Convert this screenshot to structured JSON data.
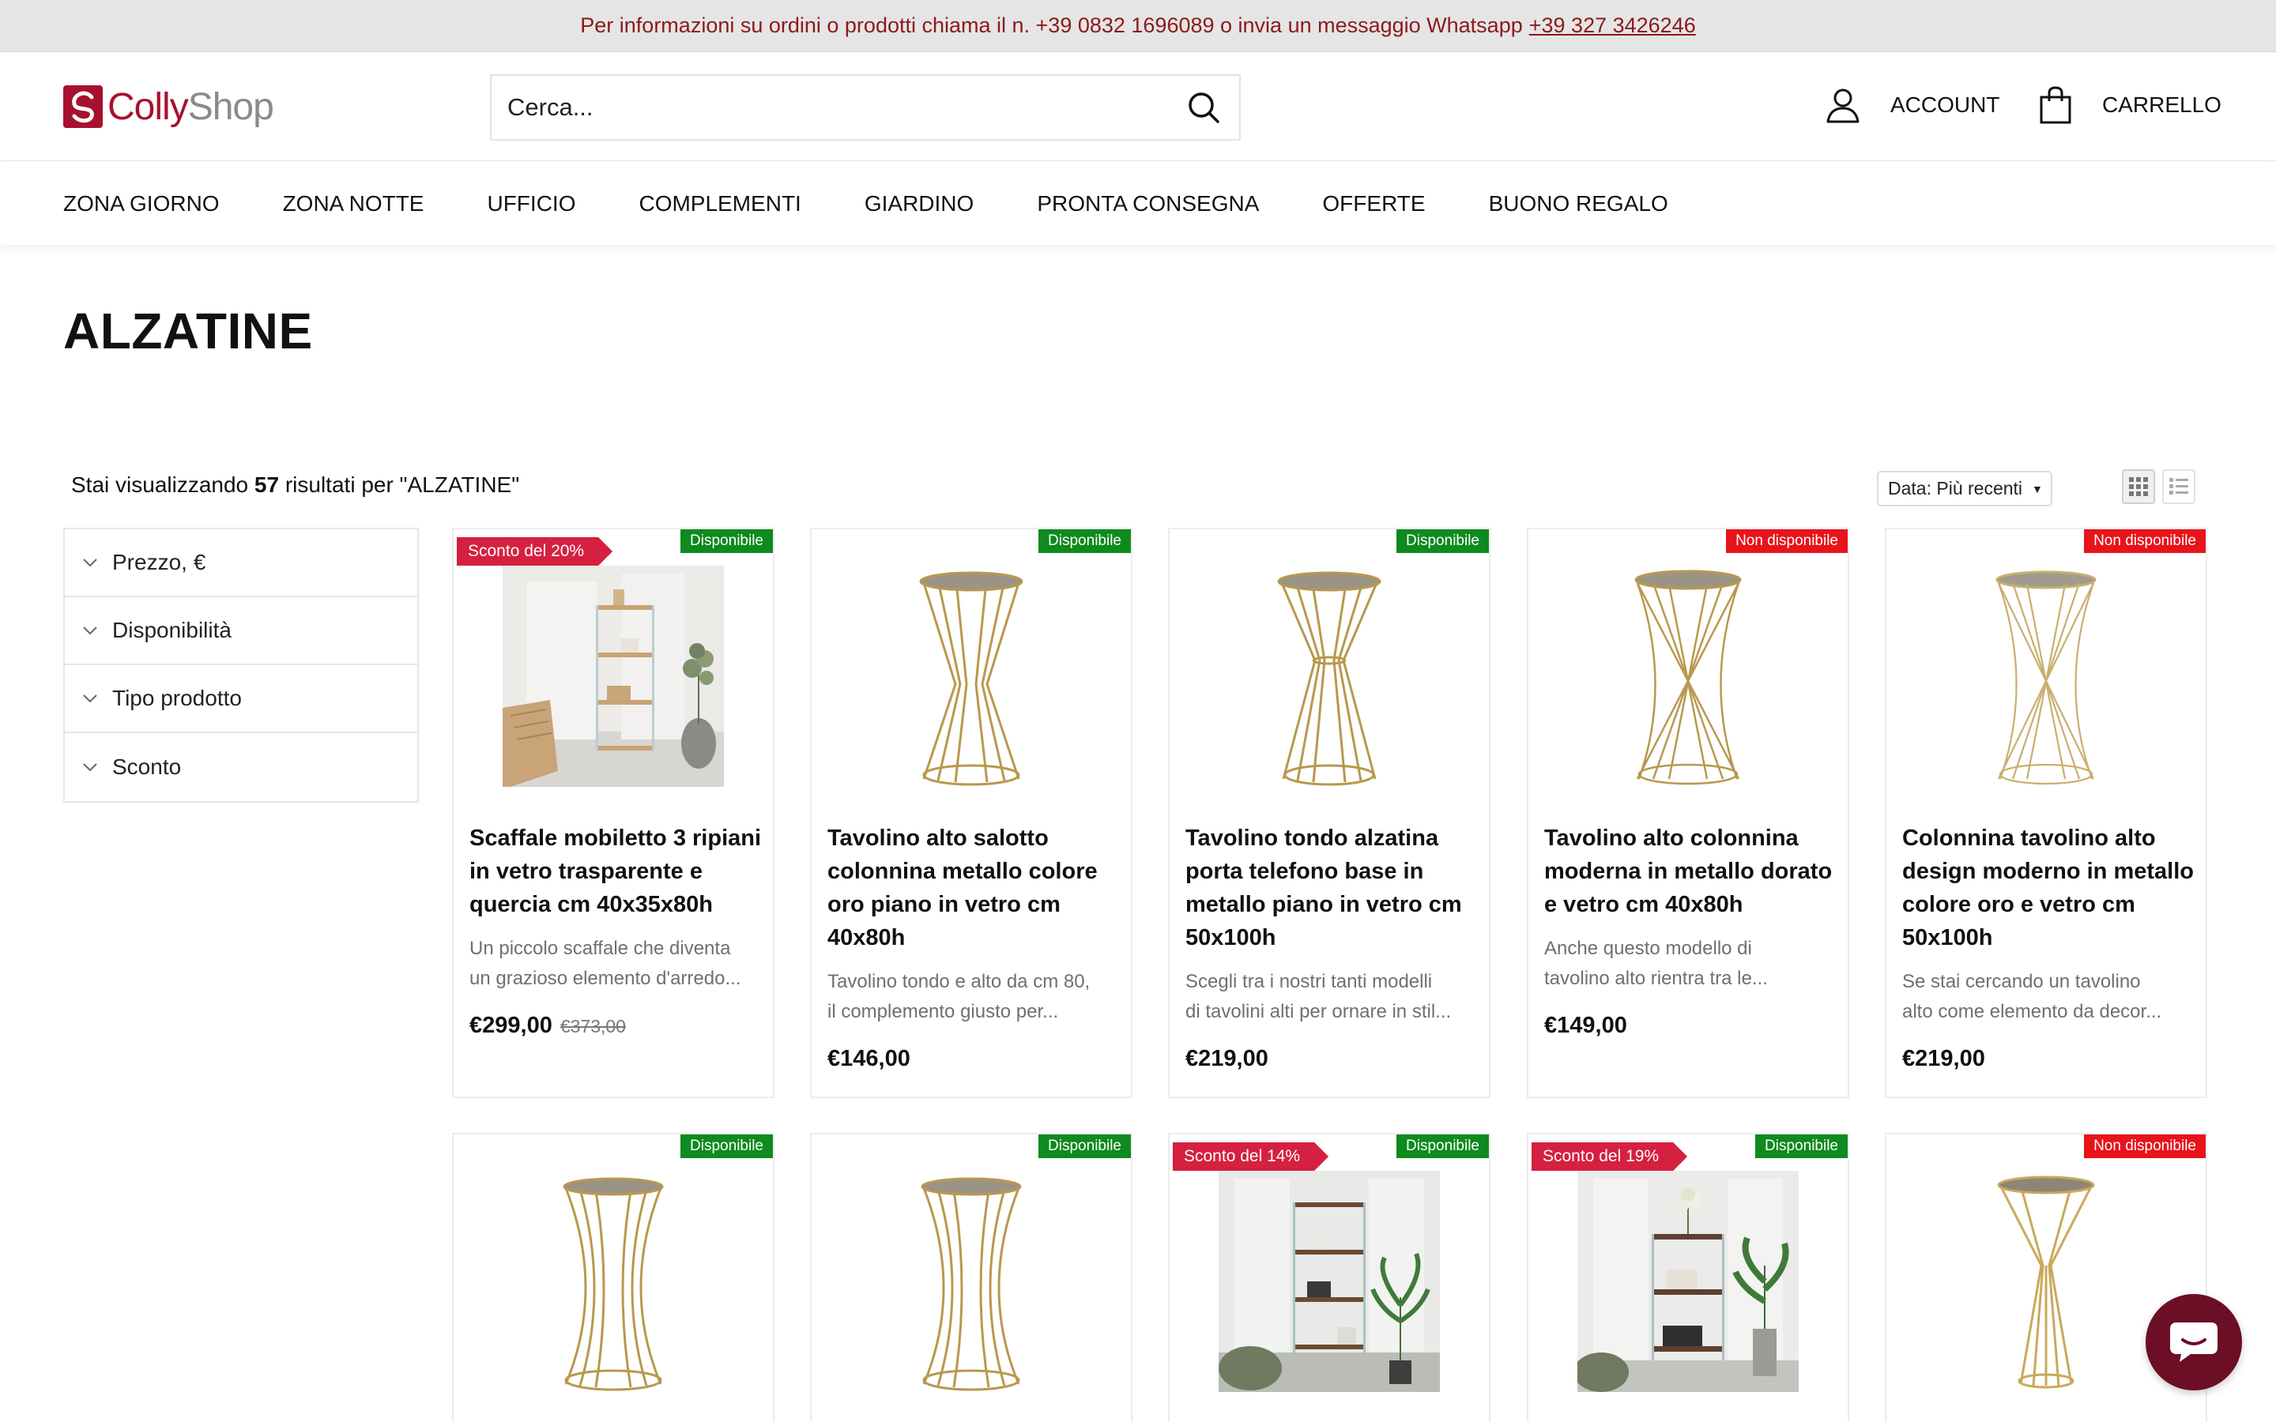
{
  "announcement": {
    "text": "Per informazioni su ordini o prodotti chiama il n. +39 0832 1696089 o invia un messaggio Whatsapp",
    "whatsapp": "+39 327 3426246"
  },
  "header": {
    "logo_part1": "Colly",
    "logo_part2": "Shop",
    "search_placeholder": "Cerca...",
    "account_label": "ACCOUNT",
    "cart_label": "CARRELLO"
  },
  "nav": [
    "ZONA GIORNO",
    "ZONA NOTTE",
    "UFFICIO",
    "COMPLEMENTI",
    "GIARDINO",
    "PRONTA CONSEGNA",
    "OFFERTE",
    "BUONO REGALO"
  ],
  "page": {
    "title": "ALZATINE",
    "results_prefix": "Stai visualizzando",
    "results_count": "57",
    "results_suffix": "risultati per \"ALZATINE\""
  },
  "sort": {
    "selected": "Data: Più recenti"
  },
  "filters": [
    "Prezzo, €",
    "Disponibilità",
    "Tipo prodotto",
    "Sconto"
  ],
  "colors": {
    "brand": "#a8102f",
    "available": "#0f8a1e",
    "unavailable": "#e8131b",
    "discount": "#d6203f",
    "chat": "#6b0e26"
  },
  "products": [
    {
      "title": "Scaffale mobiletto 3 ripiani in vetro trasparente e quercia cm 40x35x80h",
      "desc1": "Un piccolo scaffale che diventa",
      "desc2": "un grazioso elemento d'arredo...",
      "price": "€299,00",
      "old_price": "€373,00",
      "stock": "Disponibile",
      "discount": "Sconto del 20%"
    },
    {
      "title": "Tavolino alto salotto colonnina metallo colore oro piano in vetro cm 40x80h",
      "desc1": "Tavolino tondo e alto da cm 80,",
      "desc2": "il complemento giusto per...",
      "price": "€146,00",
      "stock": "Disponibile"
    },
    {
      "title": "Tavolino tondo alzatina porta telefono base in metallo piano in vetro cm 50x100h",
      "desc1": "Scegli tra i nostri tanti modelli",
      "desc2": "di tavolini alti per ornare in stil...",
      "price": "€219,00",
      "stock": "Disponibile"
    },
    {
      "title": "Tavolino alto colonnina moderna in metallo dorato e vetro cm 40x80h",
      "desc1": "Anche questo modello di",
      "desc2": "tavolino alto rientra tra le...",
      "price": "€149,00",
      "stock": "Non disponibile"
    },
    {
      "title": "Colonnina tavolino alto design moderno in metallo colore oro e vetro cm 50x100h",
      "desc1": "Se stai cercando un tavolino",
      "desc2": "alto come elemento da decor...",
      "price": "€219,00",
      "stock": "Non disponibile"
    },
    {
      "stock": "Disponibile"
    },
    {
      "stock": "Disponibile"
    },
    {
      "stock": "Disponibile",
      "discount": "Sconto del 14%"
    },
    {
      "stock": "Disponibile",
      "discount": "Sconto del 19%"
    },
    {
      "stock": "Non disponibile"
    }
  ]
}
